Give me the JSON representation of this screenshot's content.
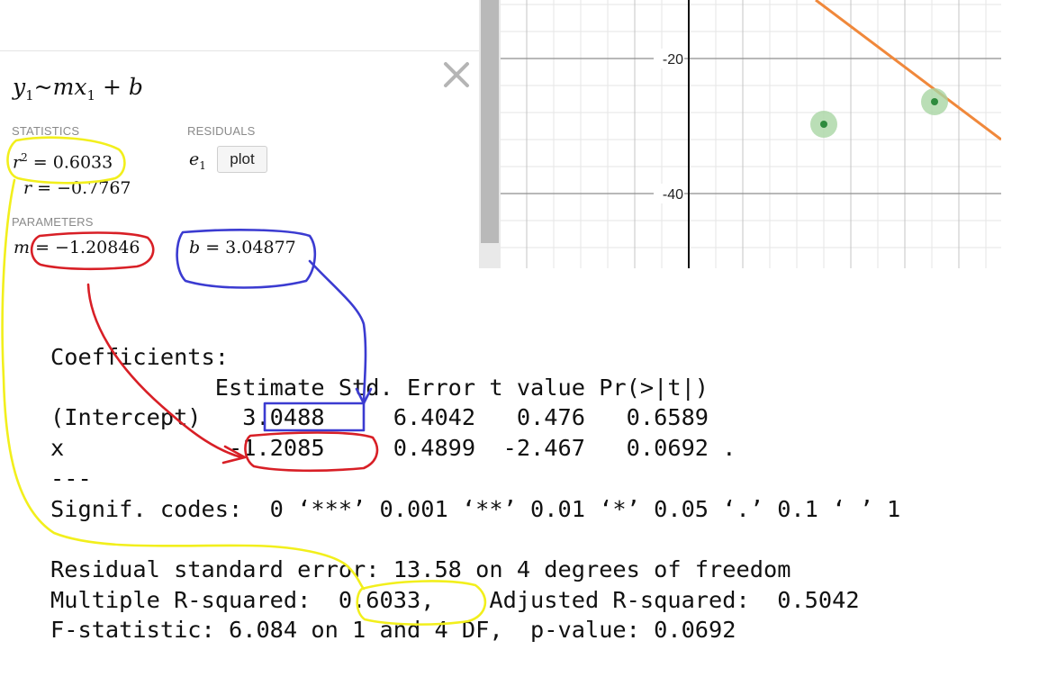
{
  "panel": {
    "formula": {
      "y": "y",
      "y_sub": "1",
      "tilde": "~",
      "m": "m",
      "x": "x",
      "x_sub": "1",
      "plus": " + ",
      "b": "b"
    },
    "statistics_heading": "STATISTICS",
    "residuals_heading": "RESIDUALS",
    "parameters_heading": "PARAMETERS",
    "r2": {
      "sym": "r",
      "sup": "2",
      "eq": " = ",
      "val": "0.6033"
    },
    "r": {
      "sym": "r",
      "eq": " = ",
      "val": "−0.7767"
    },
    "m": {
      "sym": "m",
      "eq": " = ",
      "val": "−1.20846"
    },
    "b": {
      "sym": "b",
      "eq": " = ",
      "val": "3.04877"
    },
    "residual": {
      "sym": "e",
      "sub": "1"
    },
    "plot_label": "plot"
  },
  "graph": {
    "y_ticks": [
      {
        "value": -20,
        "label": "-20"
      },
      {
        "value": -40,
        "label": "-40"
      }
    ],
    "line_color": "#f0883b",
    "point_color": "#2e8b3d",
    "halo_color": "#a9d6a4"
  },
  "r_output": {
    "lines": [
      "Coefficients:",
      "            Estimate Std. Error t value Pr(>|t|)",
      "(Intercept)   3.0488     6.4042   0.476   0.6589",
      "x            -1.2085     0.4899  -2.467   0.0692 .",
      "---",
      "Signif. codes:  0 ‘***’ 0.001 ‘**’ 0.01 ‘*’ 0.05 ‘.’ 0.1 ‘ ’ 1",
      "",
      "Residual standard error: 13.58 on 4 degrees of freedom",
      "Multiple R-squared:  0.6033,    Adjusted R-squared:  0.5042",
      "F-statistic: 6.084 on 1 and 4 DF,  p-value: 0.0692"
    ]
  },
  "annotation_colors": {
    "yellow": "#f2ef1c",
    "red": "#d81f26",
    "blue": "#3b3bd1"
  }
}
